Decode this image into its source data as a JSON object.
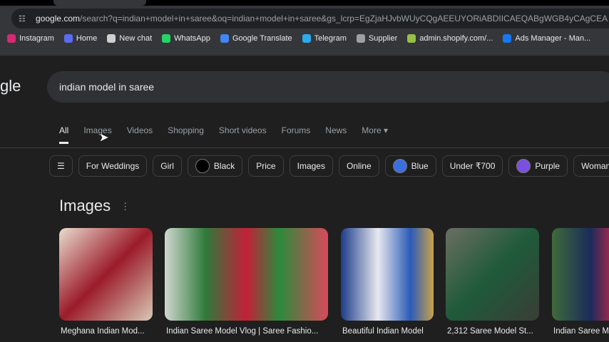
{
  "browser": {
    "url_host": "google.com",
    "url_path": "/search?q=indian+model+in+saree&oq=indian+model+in+saree&gs_lcrp=EgZjaHJvbWUyCQgAEEUYORiABDIICAEQABgWGB4yCAgCEA",
    "bookmarks": [
      {
        "label": "Instagram",
        "color": "#d62976"
      },
      {
        "label": "Home",
        "color": "#5b6cf0"
      },
      {
        "label": "New chat",
        "color": "#cfcfcf"
      },
      {
        "label": "WhatsApp",
        "color": "#25d366"
      },
      {
        "label": "Google Translate",
        "color": "#4285f4"
      },
      {
        "label": "Telegram",
        "color": "#2aabee"
      },
      {
        "label": "Supplier",
        "color": "#9aa0a6"
      },
      {
        "label": "admin.shopify.com/...",
        "color": "#95bf47"
      },
      {
        "label": "Ads Manager - Man...",
        "color": "#1877f2"
      }
    ]
  },
  "logo": "gle",
  "search": {
    "query": "indian model in saree"
  },
  "tabs": [
    "All",
    "Images",
    "Videos",
    "Shopping",
    "Short videos",
    "Forums",
    "News",
    "More ▾"
  ],
  "chips": [
    {
      "label": "For Weddings"
    },
    {
      "label": "Girl"
    },
    {
      "label": "Black",
      "swatch": "#000000"
    },
    {
      "label": "Price"
    },
    {
      "label": "Images"
    },
    {
      "label": "Online"
    },
    {
      "label": "Blue",
      "swatch": "#3b6fe0"
    },
    {
      "label": "Under ₹700"
    },
    {
      "label": "Purple",
      "swatch": "#7b4fe0"
    },
    {
      "label": "Woman"
    }
  ],
  "images_section": {
    "title": "Images",
    "results": [
      {
        "caption": "Meghana Indian Mod..."
      },
      {
        "caption": "Indian Saree Model Vlog | Saree Fashio..."
      },
      {
        "caption": "Beautiful Indian Model"
      },
      {
        "caption": "2,312 Saree Model St..."
      },
      {
        "caption": "Indian Saree M"
      }
    ]
  }
}
